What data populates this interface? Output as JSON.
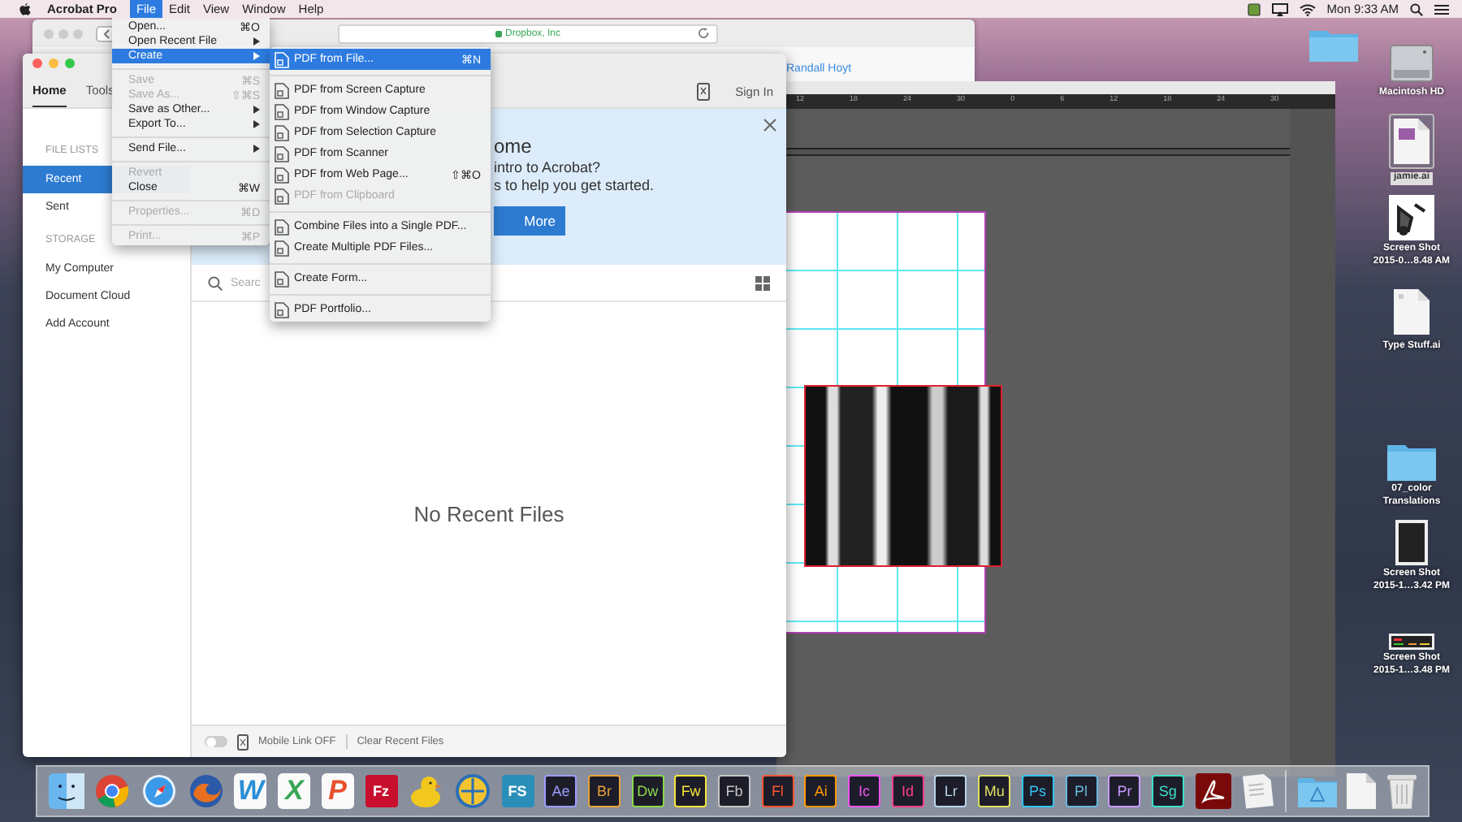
{
  "menu_bar": {
    "app_name": "Acrobat Pro",
    "menus": [
      {
        "label": "File",
        "selected": true
      },
      {
        "label": "Edit",
        "selected": false
      },
      {
        "label": "View",
        "selected": false
      },
      {
        "label": "Window",
        "selected": false
      },
      {
        "label": "Help",
        "selected": false
      }
    ],
    "clock": "Mon 9:33 AM"
  },
  "browser_window": {
    "address": "Dropbox, Inc",
    "account": "Randall Hoyt"
  },
  "illustrator_window": {
    "ruler_labels": [
      "12",
      "18",
      "24",
      "30",
      "0",
      "6",
      "12",
      "18",
      "24",
      "30"
    ]
  },
  "acrobat_window": {
    "tabs": [
      {
        "label": "Home",
        "selected": true
      },
      {
        "label": "Tools",
        "selected": false
      }
    ],
    "sign_in": "Sign In",
    "sidebar": [
      {
        "heading": "FILE LISTS",
        "items": [
          {
            "label": "Recent",
            "selected": true
          },
          {
            "label": "Sent",
            "selected": false
          }
        ]
      },
      {
        "heading": "STORAGE",
        "items": [
          {
            "label": "My Computer",
            "selected": false
          },
          {
            "label": "Document Cloud",
            "selected": false
          },
          {
            "label": "Add Account",
            "selected": false
          }
        ]
      }
    ],
    "banner": {
      "title": "ome",
      "lines": [
        "intro to Acrobat?",
        "s to help you get started."
      ],
      "button": "More"
    },
    "search": {
      "placeholder": "Searc"
    },
    "empty_message": "No Recent Files",
    "footer": {
      "mobile_link_on": false,
      "mobile_link_label": "Mobile Link OFF",
      "clear_label": "Clear Recent Files"
    }
  },
  "file_menu": [
    {
      "kind": "item",
      "label": "Open...",
      "shortcut": "⌘O",
      "submenu": false,
      "disabled": false,
      "selected": false
    },
    {
      "kind": "item",
      "label": "Open Recent File",
      "submenu": true,
      "disabled": false,
      "selected": false
    },
    {
      "kind": "item",
      "label": "Create",
      "submenu": true,
      "disabled": false,
      "selected": true
    },
    {
      "kind": "separator"
    },
    {
      "kind": "item",
      "label": "Save",
      "shortcut": "⌘S",
      "submenu": false,
      "disabled": true,
      "selected": false
    },
    {
      "kind": "item",
      "label": "Save As...",
      "shortcut": "⇧⌘S",
      "submenu": false,
      "disabled": true,
      "selected": false
    },
    {
      "kind": "item",
      "label": "Save as Other...",
      "submenu": true,
      "disabled": false,
      "selected": false
    },
    {
      "kind": "item",
      "label": "Export To...",
      "submenu": true,
      "disabled": false,
      "selected": false
    },
    {
      "kind": "separator"
    },
    {
      "kind": "item",
      "label": "Send File...",
      "submenu": true,
      "disabled": false,
      "selected": false
    },
    {
      "kind": "separator"
    },
    {
      "kind": "item",
      "label": "Revert",
      "submenu": false,
      "disabled": true,
      "selected": false
    },
    {
      "kind": "item",
      "label": "Close",
      "shortcut": "⌘W",
      "submenu": false,
      "disabled": false,
      "selected": false
    },
    {
      "kind": "separator"
    },
    {
      "kind": "item",
      "label": "Properties...",
      "shortcut": "⌘D",
      "submenu": false,
      "disabled": true,
      "selected": false
    },
    {
      "kind": "separator"
    },
    {
      "kind": "item",
      "label": "Print...",
      "shortcut": "⌘P",
      "submenu": false,
      "disabled": true,
      "selected": false
    }
  ],
  "create_submenu": [
    {
      "kind": "item",
      "label": "PDF from File...",
      "shortcut": "⌘N",
      "disabled": false,
      "selected": true
    },
    {
      "kind": "separator"
    },
    {
      "kind": "item",
      "label": "PDF from Screen Capture",
      "disabled": false,
      "selected": false
    },
    {
      "kind": "item",
      "label": "PDF from Window Capture",
      "disabled": false,
      "selected": false
    },
    {
      "kind": "item",
      "label": "PDF from Selection Capture",
      "disabled": false,
      "selected": false
    },
    {
      "kind": "item",
      "label": "PDF from Scanner",
      "disabled": false,
      "selected": false
    },
    {
      "kind": "item",
      "label": "PDF from Web Page...",
      "shortcut": "⇧⌘O",
      "disabled": false,
      "selected": false
    },
    {
      "kind": "item",
      "label": "PDF from Clipboard",
      "disabled": true,
      "selected": false
    },
    {
      "kind": "separator"
    },
    {
      "kind": "item",
      "label": "Combine Files into a Single PDF...",
      "disabled": false,
      "selected": false
    },
    {
      "kind": "item",
      "label": "Create Multiple PDF Files...",
      "disabled": false,
      "selected": false
    },
    {
      "kind": "separator"
    },
    {
      "kind": "item",
      "label": "Create Form...",
      "disabled": false,
      "selected": false
    },
    {
      "kind": "separator"
    },
    {
      "kind": "item",
      "label": "PDF Portfolio...",
      "disabled": false,
      "selected": false
    }
  ],
  "desktop_icons": [
    {
      "kind": "drive",
      "lines": [
        "Macintosh HD"
      ],
      "selected": false
    },
    {
      "kind": "document",
      "lines": [
        "jamie.ai"
      ],
      "selected": true
    },
    {
      "kind": "picture",
      "lines": [
        "Screen Shot",
        "2015-0…8.48 AM"
      ],
      "selected": false
    },
    {
      "kind": "document",
      "lines": [
        "Type Stuff.ai"
      ],
      "selected": false
    },
    {
      "kind": "folder",
      "lines": [
        "07_color",
        "Translations"
      ],
      "selected": false
    },
    {
      "kind": "dark-picture",
      "lines": [
        "Screen Shot",
        "2015-1…3.42 PM"
      ],
      "selected": false
    },
    {
      "kind": "strip-picture",
      "lines": [
        "Screen Shot",
        "2015-1…3.48 PM"
      ],
      "selected": false
    }
  ],
  "dock": [
    {
      "kind": "finder"
    },
    {
      "kind": "chrome"
    },
    {
      "kind": "safari"
    },
    {
      "kind": "firefox"
    },
    {
      "kind": "letter",
      "label": "W",
      "color": "#2b8fd6"
    },
    {
      "kind": "letter",
      "label": "X",
      "color": "#3aa655"
    },
    {
      "kind": "letter",
      "label": "P",
      "color": "#e8502c"
    },
    {
      "kind": "filled-tile",
      "label": "Fz",
      "color": "#c8102e"
    },
    {
      "kind": "duck"
    },
    {
      "kind": "globe"
    },
    {
      "kind": "filled-tile",
      "label": "FS",
      "color": "#2a8fb8"
    },
    {
      "kind": "app-tile",
      "label": "Ae",
      "color": "#9c9cff"
    },
    {
      "kind": "app-tile",
      "label": "Br",
      "color": "#e8a23a"
    },
    {
      "kind": "app-tile",
      "label": "Dw",
      "color": "#8bd94a"
    },
    {
      "kind": "app-tile",
      "label": "Fw",
      "color": "#f6e53a"
    },
    {
      "kind": "app-tile",
      "label": "Fb",
      "color": "#c5c5c5"
    },
    {
      "kind": "app-tile",
      "label": "Fl",
      "color": "#ff5533"
    },
    {
      "kind": "app-tile",
      "label": "Ai",
      "color": "#ff9a00"
    },
    {
      "kind": "app-tile",
      "label": "Ic",
      "color": "#f055f0"
    },
    {
      "kind": "app-tile",
      "label": "Id",
      "color": "#ff3d8c"
    },
    {
      "kind": "app-tile",
      "label": "Lr",
      "color": "#b8d4e8"
    },
    {
      "kind": "app-tile",
      "label": "Mu",
      "color": "#e0e060"
    },
    {
      "kind": "app-tile",
      "label": "Ps",
      "color": "#31c5f0"
    },
    {
      "kind": "app-tile",
      "label": "Pl",
      "color": "#68b8e0"
    },
    {
      "kind": "app-tile",
      "label": "Pr",
      "color": "#c89bff"
    },
    {
      "kind": "app-tile",
      "label": "Sg",
      "color": "#3de0c8"
    },
    {
      "kind": "acrobat"
    },
    {
      "kind": "paper"
    },
    {
      "kind": "separator"
    },
    {
      "kind": "apps-folder"
    },
    {
      "kind": "document"
    },
    {
      "kind": "trash"
    }
  ]
}
